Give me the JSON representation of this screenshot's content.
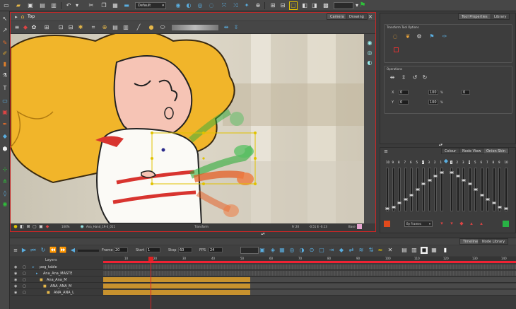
{
  "toolbar": {
    "palette_select": "Default"
  },
  "view": {
    "title": "Top",
    "tabs": [
      "Camera",
      "Drawing"
    ]
  },
  "status": {
    "drawing_name": "Ana_Hand_19-3_011",
    "zoom": "100%",
    "tool": "Transform",
    "frame": "Fr 20",
    "coords": "-0.51 E -0.13",
    "mode": "Base"
  },
  "tool_properties": {
    "tabs": [
      "Tool Properties",
      "Library"
    ],
    "section_title": "Transform Tool Options",
    "ops_title": "Operations",
    "fields": {
      "x_label": "X",
      "y_label": "Y",
      "x_val": "0",
      "y_val": "0",
      "w_val": "100",
      "h_val": "100",
      "angle_val": "0",
      "pct": "%"
    }
  },
  "onion": {
    "tabs": [
      "Colour",
      "Node View",
      "Onion Skin"
    ],
    "left_numbers": [
      "10",
      "9",
      "8",
      "7",
      "6",
      "5",
      "4",
      "3",
      "2",
      "1"
    ],
    "right_numbers": [
      "1",
      "2",
      "3",
      "4",
      "5",
      "6",
      "7",
      "8",
      "9",
      "10"
    ],
    "mode": "By Frames",
    "left_color": "#e24a1c",
    "right_color": "#28b345"
  },
  "timeline": {
    "tabs": [
      "Timeline",
      "Node Library"
    ],
    "frame_label": "Frame",
    "frame_val": "20",
    "start_label": "Start",
    "start_val": "1",
    "stop_label": "Stop",
    "stop_val": "60",
    "fps_label": "FPS",
    "fps_val": "24",
    "layers_header": "Layers",
    "ruler": [
      "10",
      "20",
      "30",
      "40",
      "50",
      "60",
      "70",
      "80",
      "90",
      "100",
      "110",
      "120",
      "130",
      "140"
    ],
    "layers": [
      "peg_table",
      "Ana_Ana_MASTE",
      "Ana_Ana_M",
      "ANA_ANA_M",
      "ANA_ANA_L"
    ]
  },
  "colors": {
    "accent": "#c92727",
    "selection": "#e0c200",
    "exposure": "#c8922e"
  }
}
